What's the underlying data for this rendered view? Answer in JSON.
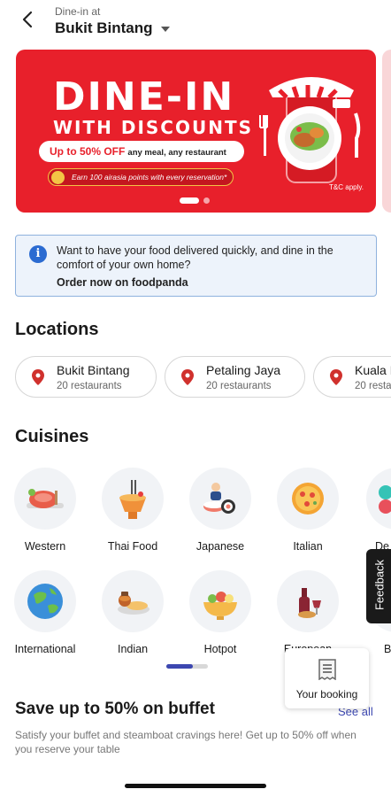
{
  "header": {
    "dine_in_at": "Dine-in at",
    "location": "Bukit Bintang"
  },
  "banner": {
    "title": "DINE-IN",
    "subtitle": "WITH DISCOUNTS",
    "offer_highlight": "Up to 50% OFF",
    "offer_rest": "any meal, any restaurant",
    "points_text": "Earn 100 airasia points with every reservation*",
    "tnc": "T&C apply.",
    "colors": {
      "background": "#e8202b",
      "gold": "#f3c545"
    }
  },
  "info": {
    "text": "Want to have your food delivered quickly, and dine in the comfort of your own home?",
    "link": "Order now on foodpanda"
  },
  "locations": {
    "title": "Locations",
    "items": [
      {
        "name": "Bukit Bintang",
        "count": "20 restaurants"
      },
      {
        "name": "Petaling Jaya",
        "count": "20 restaurants"
      },
      {
        "name": "Kuala L",
        "count": "20 resta"
      }
    ]
  },
  "cuisines": {
    "title": "Cuisines",
    "row1": [
      {
        "label": "Western",
        "icon": "steak-icon"
      },
      {
        "label": "Thai Food",
        "icon": "thai-dish-icon"
      },
      {
        "label": "Japanese",
        "icon": "sushi-icon"
      },
      {
        "label": "Italian",
        "icon": "pizza-icon"
      },
      {
        "label": "De",
        "icon": "dessert-icon"
      }
    ],
    "row2": [
      {
        "label": "International",
        "icon": "globe-icon"
      },
      {
        "label": "Indian",
        "icon": "indian-food-icon"
      },
      {
        "label": "Hotpot",
        "icon": "hotpot-icon"
      },
      {
        "label": "European",
        "icon": "wine-bread-icon"
      },
      {
        "label": "B",
        "icon": "cuisine-icon"
      }
    ]
  },
  "feedback": {
    "label": "Feedback"
  },
  "booking": {
    "label": "Your booking"
  },
  "buffet": {
    "title": "Save up to 50% on buffet",
    "see_all": "See all",
    "description": "Satisfy your buffet and steamboat cravings here! Get up to 50% off when you reserve your table"
  },
  "colors": {
    "accent": "#3c47b0",
    "info_blue": "#2b6bd1",
    "pin_red": "#d0312d"
  }
}
